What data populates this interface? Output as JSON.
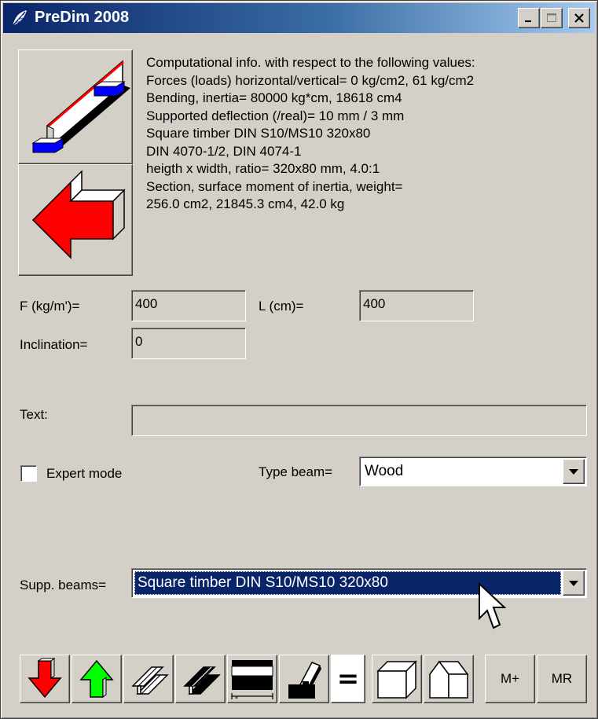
{
  "window": {
    "title": "PreDim 2008",
    "controls": {
      "minimize": "_",
      "maximize": "□",
      "close": "✕"
    }
  },
  "info_lines": [
    "Computational info. with respect to the following values:",
    "Forces (loads) horizontal/vertical= 0 kg/cm2, 61 kg/cm2",
    "Bending, inertia= 80000 kg*cm, 18618 cm4",
    "Supported deflection (/real)= 10 mm / 3 mm",
    "Square timber DIN S10/MS10 320x80",
    "DIN 4070-1/2, DIN 4074-1",
    "heigth x width, ratio= 320x80 mm, 4.0:1",
    "Section, surface moment of inertia, weight=",
    "256.0 cm2, 21845.3 cm4, 42.0 kg"
  ],
  "form": {
    "force_label": "F (kg/m')=",
    "force_value": "400",
    "length_label": "L (cm)=",
    "length_value": "400",
    "inclination_label": "Inclination=",
    "inclination_value": "0",
    "text_label": "Text:",
    "text_value": "",
    "expert_mode_label": "Expert mode",
    "expert_mode_checked": false,
    "type_beam_label": "Type beam=",
    "type_beam_value": "Wood",
    "supp_beams_label": "Supp. beams=",
    "supp_beams_value": "Square timber DIN S10/MS10 320x80"
  },
  "toolbar": {
    "icons": [
      "load-down-icon",
      "load-up-icon",
      "steel-beam-outline-icon",
      "steel-beam-dark-icon",
      "section-profile-icon",
      "column-support-icon",
      "equals-icon",
      "box-icon",
      "house-shape-icon"
    ],
    "equals_label": "=",
    "memory_plus_label": "M+",
    "memory_recall_label": "MR"
  },
  "colors": {
    "title_bar_start": "#0a246a",
    "title_bar_end": "#a6caf0",
    "window_face": "#d4d0c8",
    "selection": "#0a246a",
    "beam_red": "#ff0000",
    "support_blue": "#0000ff",
    "arrow_green": "#00ff00"
  }
}
